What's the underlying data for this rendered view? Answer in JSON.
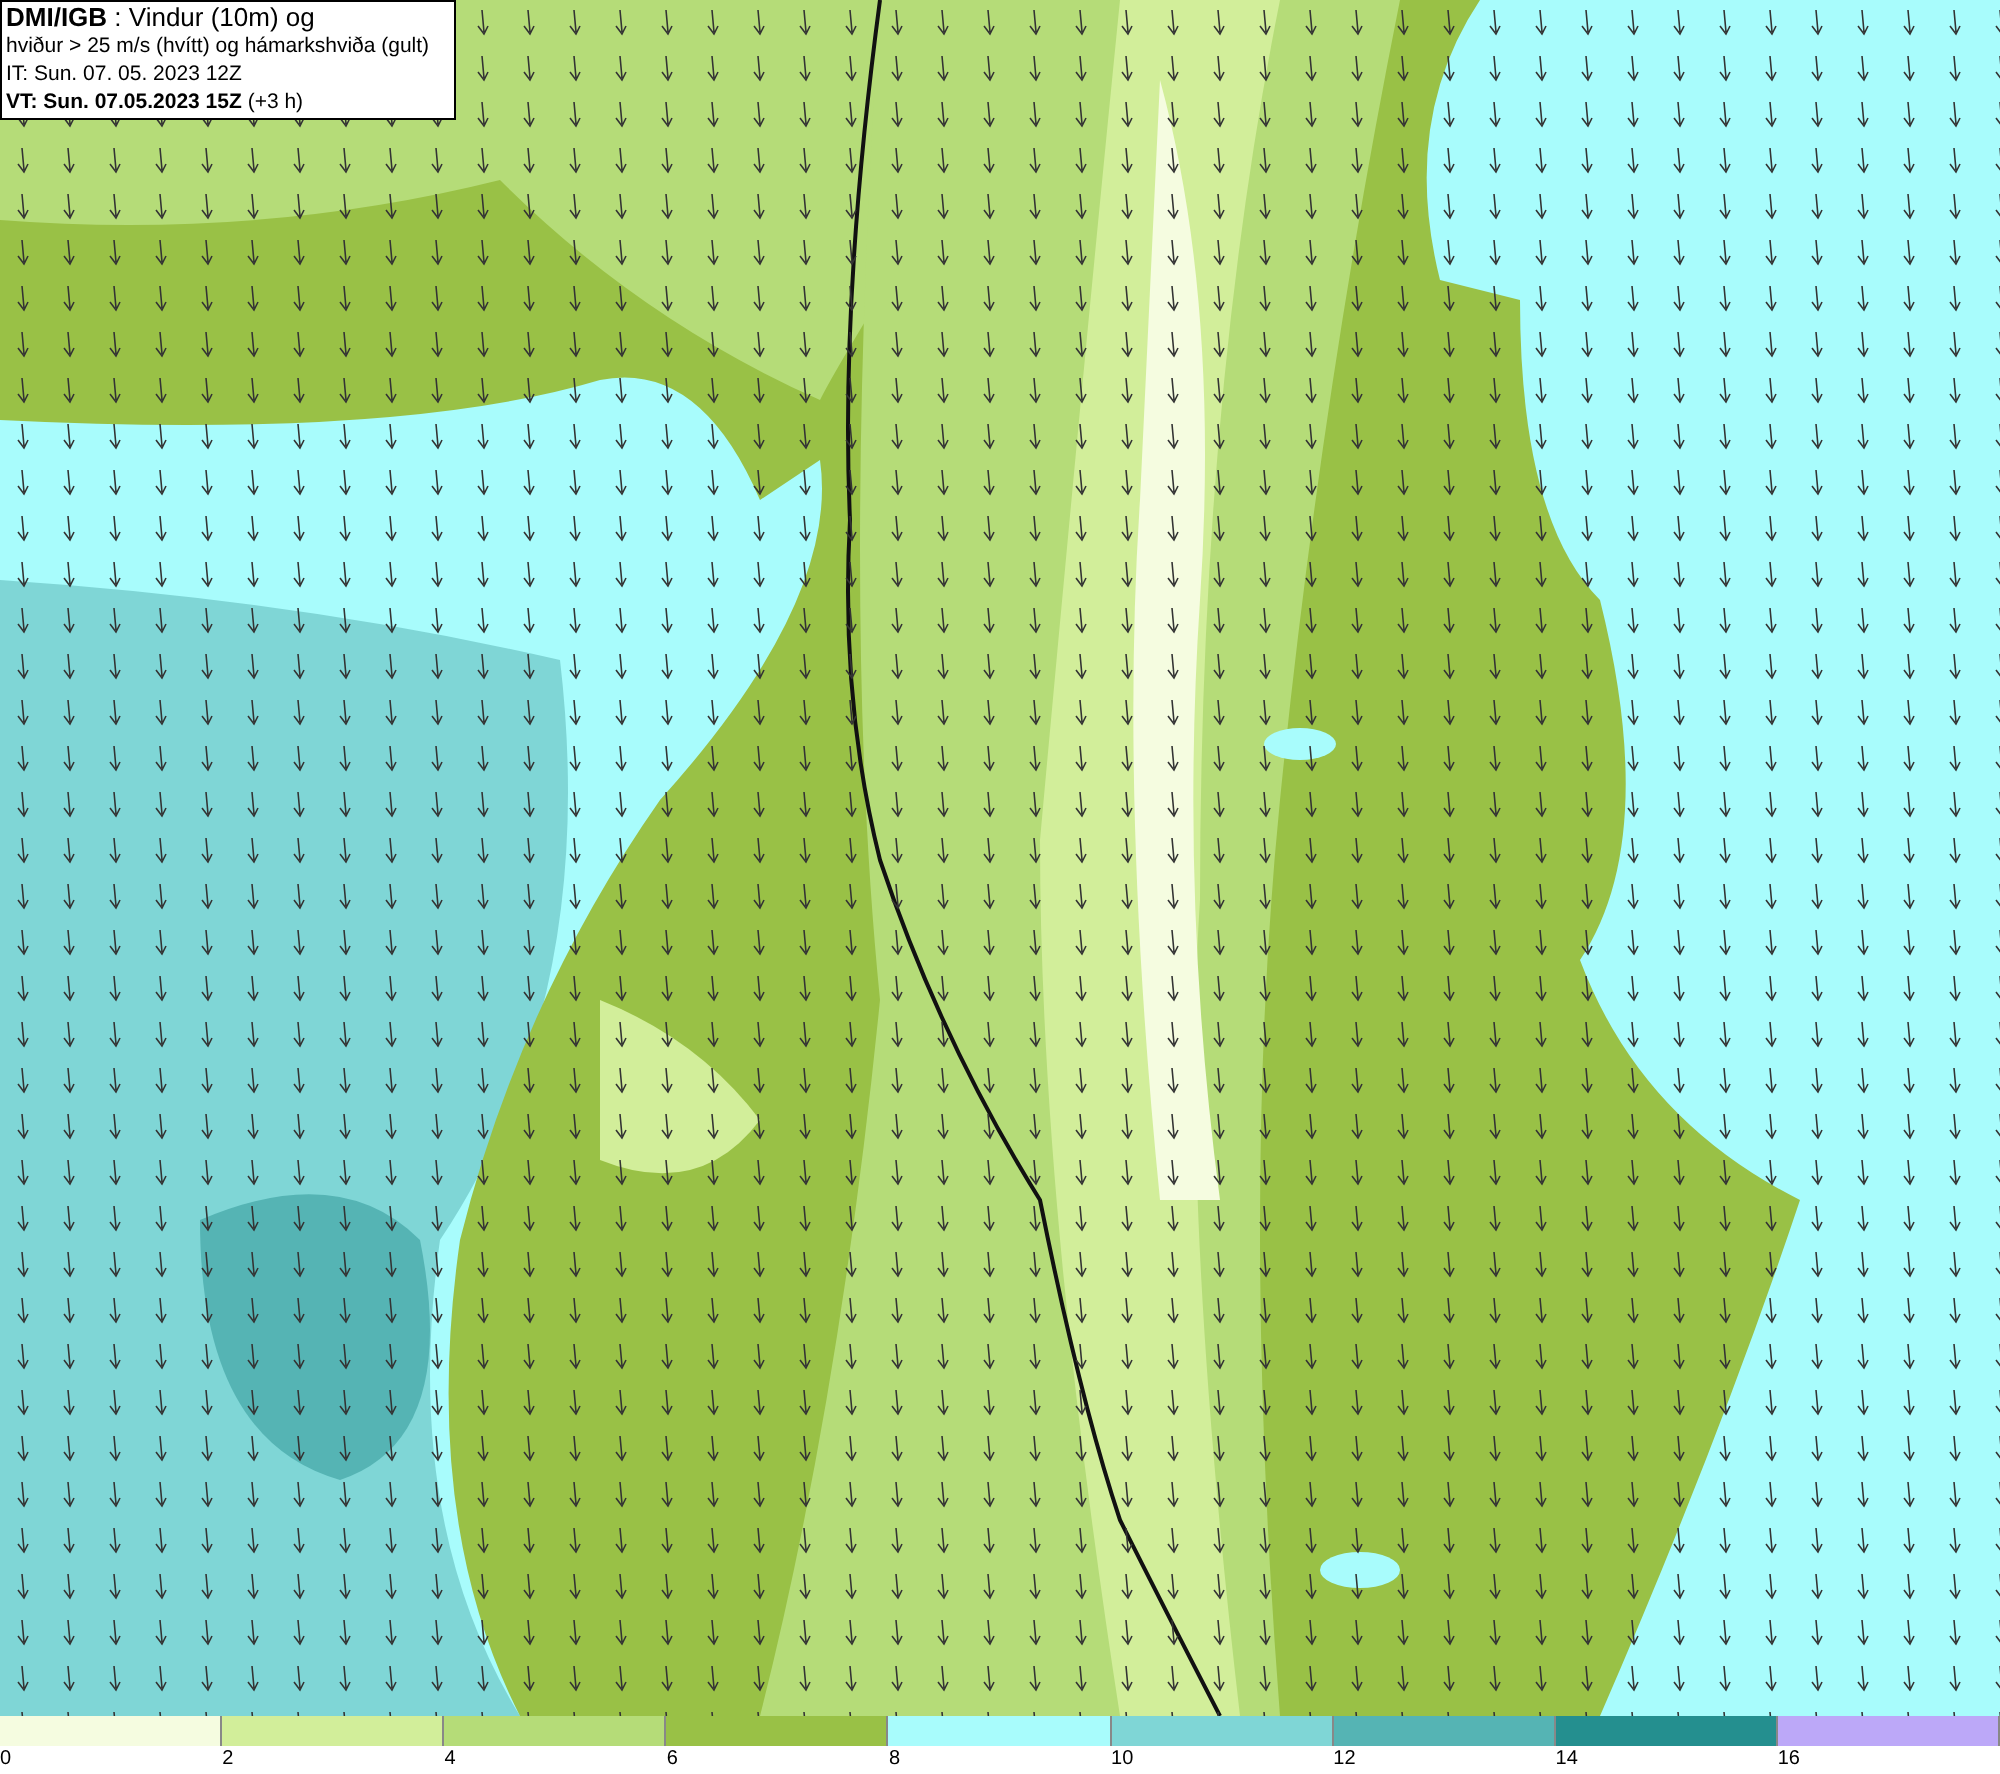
{
  "header": {
    "lines": [
      "**DMI/IGB** : Vindur (10m) og",
      "hviður > 25 m/s (hvítt) og hámarkshviða (gult)",
      "IT: Sun. 07. 05. 2023 12Z",
      "**VT: Sun. 07.05.2023 15Z** (+3 h)"
    ]
  },
  "legend": {
    "swatches": [
      {
        "color": "#f5fce0"
      },
      {
        "color": "#d2ee9a"
      },
      {
        "color": "#b5dc78"
      },
      {
        "color": "#99c146"
      },
      {
        "color": "#a8fcfc"
      },
      {
        "color": "#7fd6d6"
      },
      {
        "color": "#55b4b4"
      },
      {
        "color": "#248f8f"
      },
      {
        "color": "#bca8f8"
      }
    ],
    "ticks": [
      "0",
      "2",
      "4",
      "6",
      "8",
      "10",
      "12",
      "14",
      "16"
    ]
  }
}
